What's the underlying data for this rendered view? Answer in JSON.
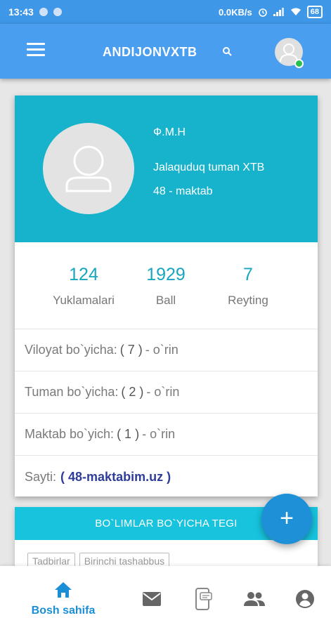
{
  "status_bar": {
    "time": "13:43",
    "network_speed": "0.0KB/s",
    "battery": "68"
  },
  "app_bar": {
    "title": "ANDIJONVXTB",
    "icons": [
      "menu-icon",
      "search-icon",
      "avatar-icon"
    ]
  },
  "profile": {
    "name": "Ф.М.Н",
    "district": "Jalaquduq tuman XTB",
    "school": "48 - maktab"
  },
  "stats": [
    {
      "value": "124",
      "label": "Yuklamalari"
    },
    {
      "value": "1929",
      "label": "Ball"
    },
    {
      "value": "7",
      "label": "Reyting"
    }
  ],
  "rankings": {
    "viloyat": {
      "label": "Viloyat bo`yicha:",
      "value": "( 7 )",
      "suffix": "- o`rin"
    },
    "tuman": {
      "label": "Tuman bo`yicha:",
      "value": "( 2 )",
      "suffix": "- o`rin"
    },
    "maktab": {
      "label": "Maktab bo`yich:",
      "value": "( 1 )",
      "suffix": "- o`rin"
    },
    "sayt": {
      "label": "Sayti:",
      "link": "( 48-maktabim.uz )"
    }
  },
  "section": {
    "title": "BO`LIMLAR BO`YICHA TEGI",
    "chips": [
      "Tadbirlar",
      "Birinchi tashabbus"
    ]
  },
  "fab": {
    "label": "+"
  },
  "bottom_nav": {
    "home_label": "Bosh sahifa",
    "items": [
      "home-icon",
      "mail-icon",
      "sms-icon",
      "people-icon",
      "account-icon"
    ],
    "active_color": "#1a8ed6"
  },
  "colors": {
    "status_bar": "#3f97e8",
    "app_bar": "#4a9ef0",
    "card_header": "#17b2cb",
    "accent": "#17a5c0",
    "link": "#2f3d9a",
    "fab": "#1e90d8"
  }
}
